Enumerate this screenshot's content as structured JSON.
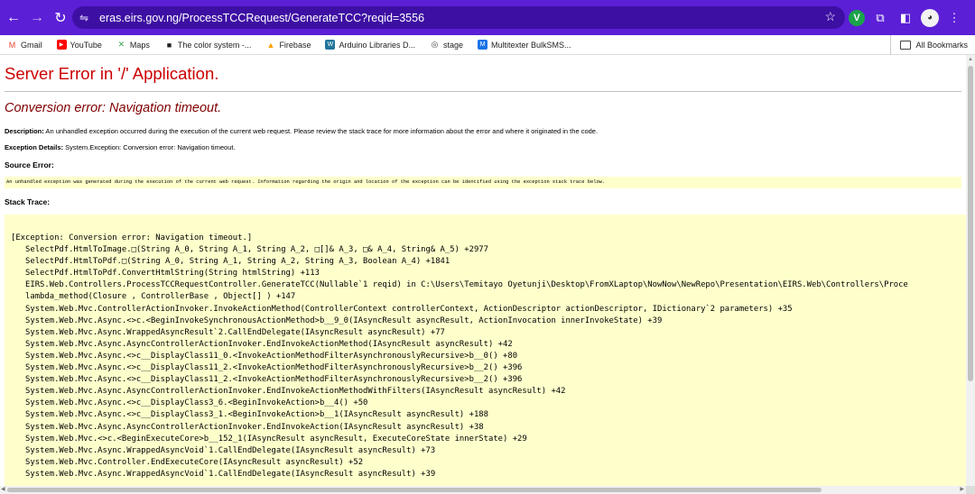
{
  "toolbar": {
    "back_icon": "←",
    "forward_icon": "→",
    "reload_icon": "↻",
    "site_info_icon": "⇋",
    "url": "eras.eirs.gov.ng/ProcessTCCRequest/GenerateTCC?reqid=3556",
    "star_icon": "☆",
    "ext_v": "V",
    "ext_puzzle": "⧉",
    "sidebar_icon": "◧",
    "avatar": "◕",
    "menu_icon": "⋮"
  },
  "bookmarks": {
    "items": [
      {
        "label": "Gmail",
        "icon": "M",
        "color": "#ea4335"
      },
      {
        "label": "YouTube",
        "icon": "▶",
        "color": "#ff0000"
      },
      {
        "label": "Maps",
        "icon": "✕",
        "color": "#34a853"
      },
      {
        "label": "The color system -...",
        "icon": "■",
        "color": "#222222"
      },
      {
        "label": "Firebase",
        "icon": "▲",
        "color": "#ffa000"
      },
      {
        "label": "Arduino Libraries D...",
        "icon": "W",
        "color": "#21759b"
      },
      {
        "label": "stage",
        "icon": "◎",
        "color": "#444444"
      },
      {
        "label": "Multitexter BulkSMS...",
        "icon": "M",
        "color": "#1a73e8"
      }
    ],
    "all_bookmarks": "All Bookmarks"
  },
  "page": {
    "title": "Server Error in '/' Application.",
    "subtitle": "Conversion error: Navigation timeout.",
    "description_label": "Description:",
    "description_text": " An unhandled exception occurred during the execution of the current web request. Please review the stack trace for more information about the error and where it originated in the code.",
    "exception_label": "Exception Details:",
    "exception_text": " System.Exception: Conversion error: Navigation timeout.",
    "source_error_label": "Source Error:",
    "source_error_text": "An unhandled exception was generated during the execution of the current web request. Information regarding the origin and location of the exception can be identified using the exception stack trace below.",
    "stack_trace_label": "Stack Trace:",
    "stack_lines": [
      "[Exception: Conversion error: Navigation timeout.]",
      "   SelectPdf.HtmlToImage.□(String A_0, String A_1, String A_2, □[]& A_3, □& A_4, String& A_5) +2977",
      "   SelectPdf.HtmlToPdf.□(String A_0, String A_1, String A_2, String A_3, Boolean A_4) +1841",
      "   SelectPdf.HtmlToPdf.ConvertHtmlString(String htmlString) +113",
      "   EIRS.Web.Controllers.ProcessTCCRequestController.GenerateTCC(Nullable`1 reqid) in C:\\Users\\Temitayo Oyetunji\\Desktop\\FromXLaptop\\NowNow\\NewRepo\\Presentation\\EIRS.Web\\Controllers\\Proce",
      "   lambda_method(Closure , ControllerBase , Object[] ) +147",
      "   System.Web.Mvc.ControllerActionInvoker.InvokeActionMethod(ControllerContext controllerContext, ActionDescriptor actionDescriptor, IDictionary`2 parameters) +35",
      "   System.Web.Mvc.Async.<>c.<BeginInvokeSynchronousActionMethod>b__9_0(IAsyncResult asyncResult, ActionInvocation innerInvokeState) +39",
      "   System.Web.Mvc.Async.WrappedAsyncResult`2.CallEndDelegate(IAsyncResult asyncResult) +77",
      "   System.Web.Mvc.Async.AsyncControllerActionInvoker.EndInvokeActionMethod(IAsyncResult asyncResult) +42",
      "   System.Web.Mvc.Async.<>c__DisplayClass11_0.<InvokeActionMethodFilterAsynchronouslyRecursive>b__0() +80",
      "   System.Web.Mvc.Async.<>c__DisplayClass11_2.<InvokeActionMethodFilterAsynchronouslyRecursive>b__2() +396",
      "   System.Web.Mvc.Async.<>c__DisplayClass11_2.<InvokeActionMethodFilterAsynchronouslyRecursive>b__2() +396",
      "   System.Web.Mvc.Async.AsyncControllerActionInvoker.EndInvokeActionMethodWithFilters(IAsyncResult asyncResult) +42",
      "   System.Web.Mvc.Async.<>c__DisplayClass3_6.<BeginInvokeAction>b__4() +50",
      "   System.Web.Mvc.Async.<>c__DisplayClass3_1.<BeginInvokeAction>b__1(IAsyncResult asyncResult) +188",
      "   System.Web.Mvc.Async.AsyncControllerActionInvoker.EndInvokeAction(IAsyncResult asyncResult) +38",
      "   System.Web.Mvc.<>c.<BeginExecuteCore>b__152_1(IAsyncResult asyncResult, ExecuteCoreState innerState) +29",
      "   System.Web.Mvc.Async.WrappedAsyncVoid`1.CallEndDelegate(IAsyncResult asyncResult) +73",
      "   System.Web.Mvc.Controller.EndExecuteCore(IAsyncResult asyncResult) +52",
      "   System.Web.Mvc.Async.WrappedAsyncVoid`1.CallEndDelegate(IAsyncResult asyncResult) +39"
    ]
  }
}
